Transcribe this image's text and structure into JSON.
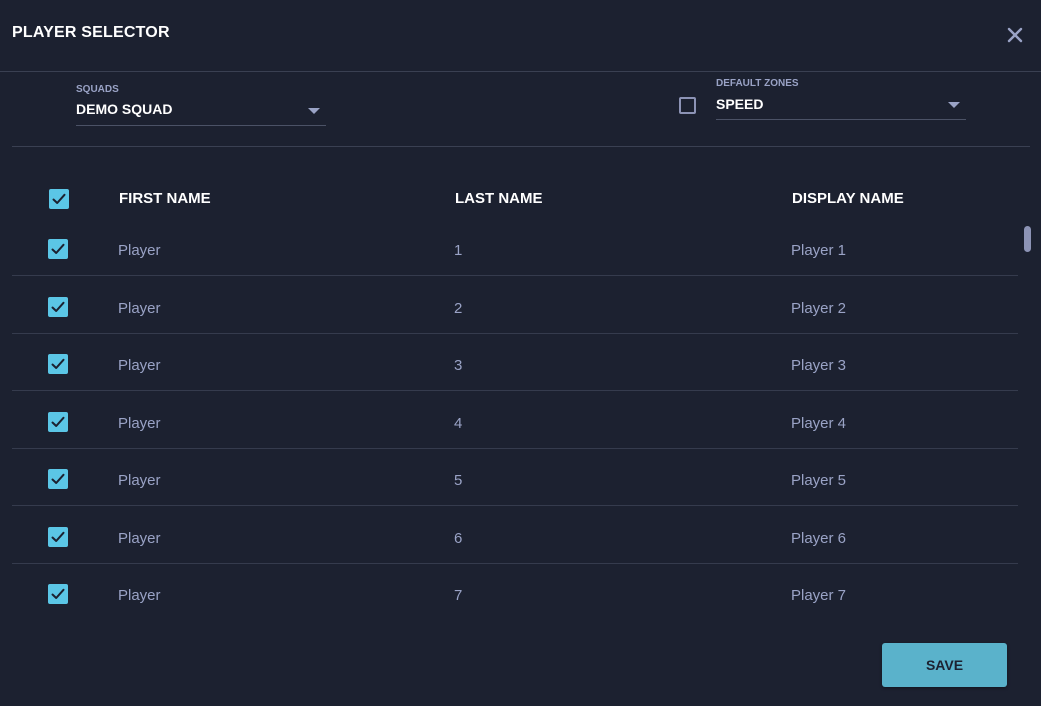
{
  "header": {
    "title": "PLAYER SELECTOR",
    "close_icon": "close-icon"
  },
  "squads": {
    "label": "SQUADS",
    "value": "DEMO SQUAD"
  },
  "default_zones": {
    "label": "DEFAULT ZONES",
    "value": "SPEED",
    "checked": false
  },
  "table": {
    "select_all_checked": true,
    "columns": [
      "FIRST NAME",
      "LAST NAME",
      "DISPLAY NAME"
    ],
    "rows": [
      {
        "checked": true,
        "first_name": "Player",
        "last_name": "1",
        "display_name": "Player 1"
      },
      {
        "checked": true,
        "first_name": "Player",
        "last_name": "2",
        "display_name": "Player 2"
      },
      {
        "checked": true,
        "first_name": "Player",
        "last_name": "3",
        "display_name": "Player 3"
      },
      {
        "checked": true,
        "first_name": "Player",
        "last_name": "4",
        "display_name": "Player 4"
      },
      {
        "checked": true,
        "first_name": "Player",
        "last_name": "5",
        "display_name": "Player 5"
      },
      {
        "checked": true,
        "first_name": "Player",
        "last_name": "6",
        "display_name": "Player 6"
      },
      {
        "checked": true,
        "first_name": "Player",
        "last_name": "7",
        "display_name": "Player 7"
      }
    ]
  },
  "footer": {
    "save_label": "SAVE"
  },
  "colors": {
    "background": "#1c2130",
    "accent": "#5bc6e6",
    "button": "#5ab2cb",
    "muted_text": "#9aa3c6"
  }
}
